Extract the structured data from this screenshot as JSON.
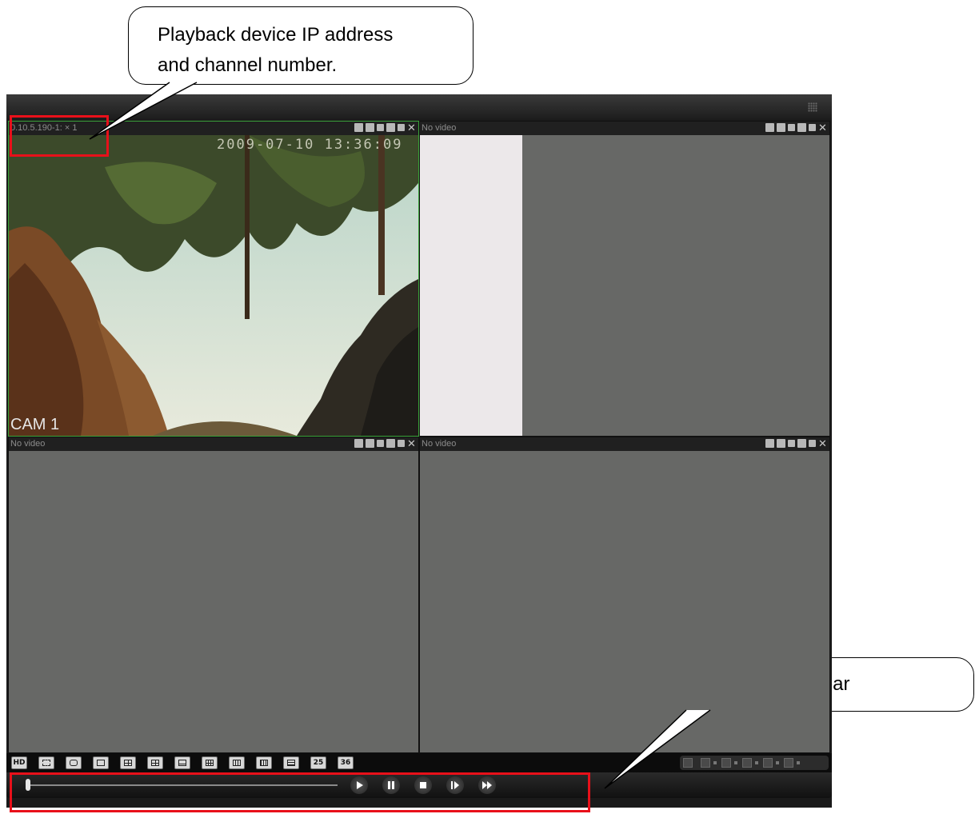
{
  "callouts": {
    "top": "Playback device IP address and channel number.",
    "top_line1": "Playback device IP address",
    "top_line2": "and channel number.",
    "bottom": "Playback control bar"
  },
  "panes": [
    {
      "label": "0.10.5.190-1: × 1",
      "has_video": true,
      "timestamp": "2009-07-10 13:36:09",
      "camera": "CAM 1"
    },
    {
      "label": "No video",
      "has_video": false
    },
    {
      "label": "No video",
      "has_video": false
    },
    {
      "label": "No video",
      "has_video": false
    }
  ],
  "pane_tool_icons": [
    "record-icon",
    "snapshot-icon",
    "zoom-icon",
    "camera-icon",
    "audio-icon",
    "close-icon"
  ],
  "layout_buttons": [
    "HD",
    "",
    "",
    "",
    "",
    "",
    "",
    "",
    "",
    "",
    "",
    "25",
    "36"
  ],
  "layout_icons": [
    "hd-icon",
    "fullscreen-alt-icon",
    "fullscreen-icon",
    "layout-1-icon",
    "layout-4-icon",
    "layout-6-icon",
    "layout-8-icon",
    "layout-9-icon",
    "layout-13-icon",
    "layout-16-icon",
    "layout-20-icon",
    "layout-25-icon",
    "layout-36-icon"
  ],
  "playback": {
    "progress": 0.0,
    "buttons": [
      "play-icon",
      "pause-icon",
      "stop-icon",
      "step-forward-icon",
      "fast-forward-icon"
    ]
  },
  "colors": {
    "highlight": "#e8101a",
    "active_pane_border": "#3aa23a"
  }
}
